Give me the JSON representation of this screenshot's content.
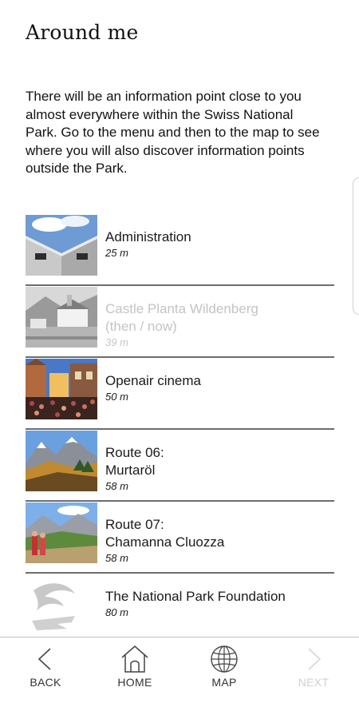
{
  "header": {
    "title": "Around me"
  },
  "intro": "There will be an information point close to you almost everywhere within the Swiss National Park. Go to the menu and then to the map to see where you will also discover information points outside the Park.",
  "items": [
    {
      "name": "Administration",
      "distance": "25 m",
      "thumbnail": "building-photo"
    },
    {
      "name": "Castle Planta Wildenberg\n(then / now)",
      "distance": "39 m",
      "thumbnail": "castle-photo"
    },
    {
      "name": "Openair cinema",
      "distance": "50 m",
      "thumbnail": "cinema-photo"
    },
    {
      "name": "Route 06:\nMurtaröl",
      "distance": "58 m",
      "thumbnail": "mountain-photo"
    },
    {
      "name": "Route 07:\nChamanna Cluozza",
      "distance": "58 m",
      "thumbnail": "hikers-photo"
    },
    {
      "name": "The National Park Foundation",
      "distance": "80 m",
      "thumbnail": "foundation-logo"
    }
  ],
  "nav": {
    "back": "BACK",
    "home": "HOME",
    "map": "MAP",
    "next": "NEXT"
  }
}
